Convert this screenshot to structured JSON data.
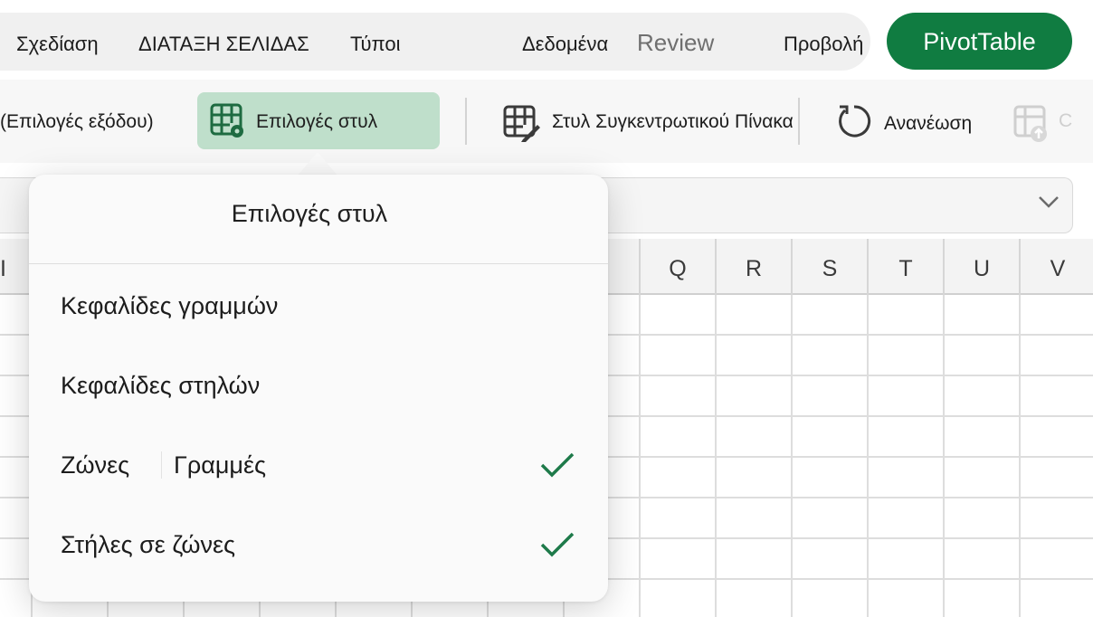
{
  "tabs": {
    "items": [
      "Σχεδίαση",
      "ΔΙΑΤΑΞΗ ΣΕΛΙΔΑΣ",
      "Τύποι",
      "Δεδομένα",
      "Review",
      "Προβολή"
    ],
    "active": "PivotTable"
  },
  "ribbon": {
    "output_options": "(Επιλογές εξόδου)",
    "style_options": "Επιλογές στυλ",
    "pivot_style": "Στυλ Συγκεντρωτικού Πίνακα",
    "refresh": "Ανανέωση",
    "truncated": "C"
  },
  "grid": {
    "columns": [
      "Q",
      "R",
      "S",
      "T",
      "U",
      "V"
    ],
    "left_partial_col": "I"
  },
  "popover": {
    "title": "Επιλογές στυλ",
    "options": [
      {
        "label": "Κεφαλίδες γραμμών",
        "checked": false
      },
      {
        "label": "Κεφαλίδες στηλών",
        "checked": false
      },
      {
        "label": "Ζώνες",
        "label2": "Γραμμές",
        "checked": true
      },
      {
        "label": "Στήλες σε ζώνες",
        "checked": true
      }
    ]
  },
  "colors": {
    "accent": "#107c41",
    "check": "#1e7a4a",
    "active_bg": "#bfdfcb"
  },
  "icons": [
    "table-style-options-icon",
    "pivot-style-icon",
    "refresh-icon",
    "change-source-icon",
    "chevron-down-icon",
    "checkmark-icon"
  ]
}
